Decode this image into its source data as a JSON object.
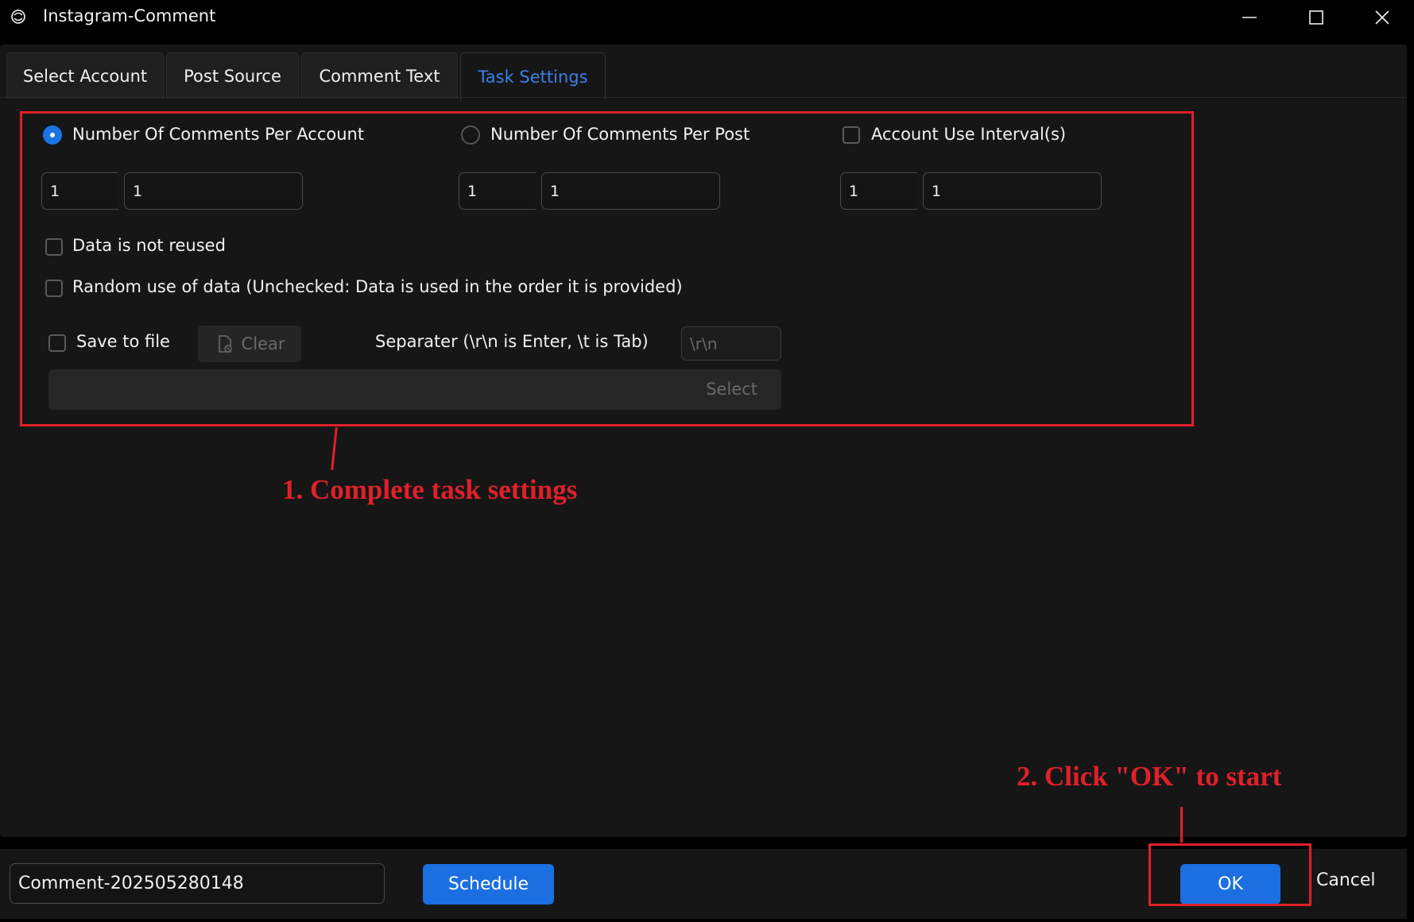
{
  "window": {
    "title": "Instagram-Comment",
    "icons": [
      "app-icon",
      "minimize-icon",
      "maximize-icon",
      "close-icon"
    ]
  },
  "tabs": [
    {
      "label": "Select Account",
      "active": false
    },
    {
      "label": "Post Source",
      "active": false
    },
    {
      "label": "Comment Text",
      "active": false
    },
    {
      "label": "Task Settings",
      "active": true
    }
  ],
  "settings": {
    "option_per_account": {
      "label": "Number Of Comments Per Account",
      "selected": true,
      "min": "1",
      "max": "1"
    },
    "option_per_post": {
      "label": "Number Of Comments Per Post",
      "selected": false,
      "min": "1",
      "max": "1"
    },
    "option_interval": {
      "label": "Account Use Interval(s)",
      "checked": false,
      "min": "1",
      "max": "1"
    },
    "data_not_reused": {
      "label": "Data is not reused",
      "checked": false
    },
    "random_use": {
      "label": "Random use of data (Unchecked: Data is used in the order it is provided)",
      "checked": false
    },
    "save_to_file": {
      "label": "Save to file",
      "checked": false
    },
    "clear_button": "Clear",
    "separator_label": "Separater (\\r\\n is Enter, \\t is Tab)",
    "separator_placeholder": "\\r\\n",
    "select_button": "Select"
  },
  "annotations": {
    "step1": "1. Complete task settings",
    "step2": "2. Click \"OK\" to start"
  },
  "footer": {
    "task_name": "Comment-202505280148",
    "schedule_button": "Schedule",
    "ok_button": "OK",
    "cancel_button": "Cancel"
  },
  "colors": {
    "accent": "#1b6fe0",
    "annotation_red": "#e0202a",
    "panel_bg": "#161616"
  }
}
